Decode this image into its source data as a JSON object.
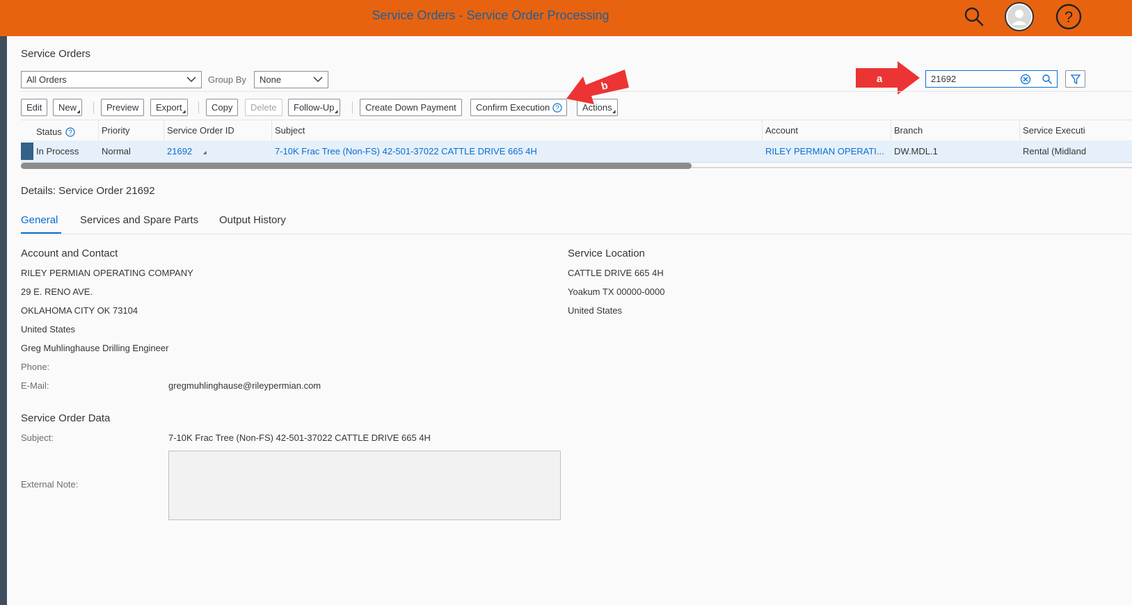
{
  "shell": {
    "title": "Service Orders - Service Order Processing",
    "icons": [
      "search-icon",
      "user-avatar-icon",
      "help-icon"
    ],
    "brand_color": "#e8630f"
  },
  "page": {
    "heading": "Service Orders"
  },
  "filter": {
    "view_select": "All Orders",
    "group_by_label": "Group By",
    "group_by_value": "None",
    "search_value": "21692"
  },
  "annotations": {
    "a": "a",
    "b": "b"
  },
  "toolbar": {
    "edit": "Edit",
    "new": "New",
    "preview": "Preview",
    "export": "Export",
    "copy": "Copy",
    "delete": "Delete",
    "follow_up": "Follow-Up",
    "create_down_payment": "Create Down Payment",
    "confirm_execution": "Confirm Execution",
    "actions": "Actions"
  },
  "table": {
    "columns": {
      "status": "Status",
      "priority": "Priority",
      "id": "Service Order ID",
      "subject": "Subject",
      "account": "Account",
      "branch": "Branch",
      "execution": "Service Executi"
    },
    "row": {
      "status": "In Process",
      "priority": "Normal",
      "id": "21692",
      "subject": "7-10K Frac Tree (Non-FS) 42-501-37022 CATTLE DRIVE 665 4H",
      "account": "RILEY PERMIAN OPERATI...",
      "branch": "DW.MDL.1",
      "execution": "Rental (Midland"
    }
  },
  "details": {
    "heading": "Details: Service Order 21692",
    "tabs": [
      "General",
      "Services and Spare Parts",
      "Output History"
    ],
    "account_contact": {
      "heading": "Account and Contact",
      "account": "RILEY PERMIAN OPERATING COMPANY",
      "address1": "29 E. RENO AVE.",
      "address2": "OKLAHOMA CITY OK  73104",
      "country": "United States",
      "contact": "Greg Muhlinghause Drilling Engineer",
      "phone_label": "Phone:",
      "email_label": "E-Mail:",
      "email": "gregmuhlinghause@rileypermian.com"
    },
    "service_location": {
      "heading": "Service Location",
      "line1": "CATTLE DRIVE 665 4H",
      "line2": "Yoakum TX  00000-0000",
      "country": "United States"
    },
    "order_data": {
      "heading": "Service Order Data",
      "subject_label": "Subject:",
      "subject": "7-10K Frac Tree (Non-FS) 42-501-37022 CATTLE DRIVE 665 4H",
      "note_label": "External Note:",
      "note": ""
    }
  }
}
